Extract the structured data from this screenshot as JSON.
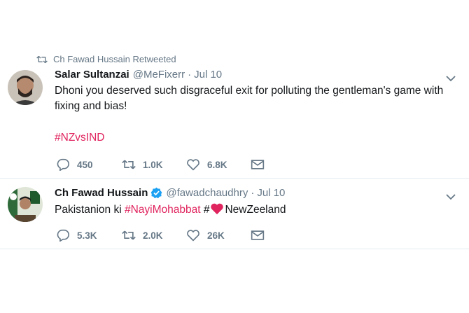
{
  "tweet1": {
    "retweeted_by": "Ch Fawad Hussain Retweeted",
    "name": "Salar Sultanzai",
    "handle": "@MeFixerr",
    "dot": "·",
    "date": "Jul 10",
    "text": "Dhoni you deserved such disgraceful exit for polluting the gentleman's game with fixing and bias!",
    "hashtag": "#NZvsIND",
    "replies": "450",
    "retweets": "1.0K",
    "likes": "6.8K"
  },
  "tweet2": {
    "name": "Ch Fawad Hussain",
    "handle": "@fawadchaudhry",
    "dot": "·",
    "date": "Jul 10",
    "text_prefix": "Pakistanion ki ",
    "hashtag": "#NayiMohabbat",
    "text_hash": " #",
    "text_suffix": "NewZeeland",
    "replies": "5.3K",
    "retweets": "2.0K",
    "likes": "26K"
  },
  "colors": {
    "hashtag": "#e0245e",
    "secondary_text": "#657786",
    "verified": "#1da1f2",
    "heart": "#e0245e"
  },
  "icons": [
    "retweet-icon",
    "chevron-down-icon",
    "reply-icon",
    "like-icon",
    "message-icon",
    "verified-icon",
    "heart-emoji"
  ]
}
